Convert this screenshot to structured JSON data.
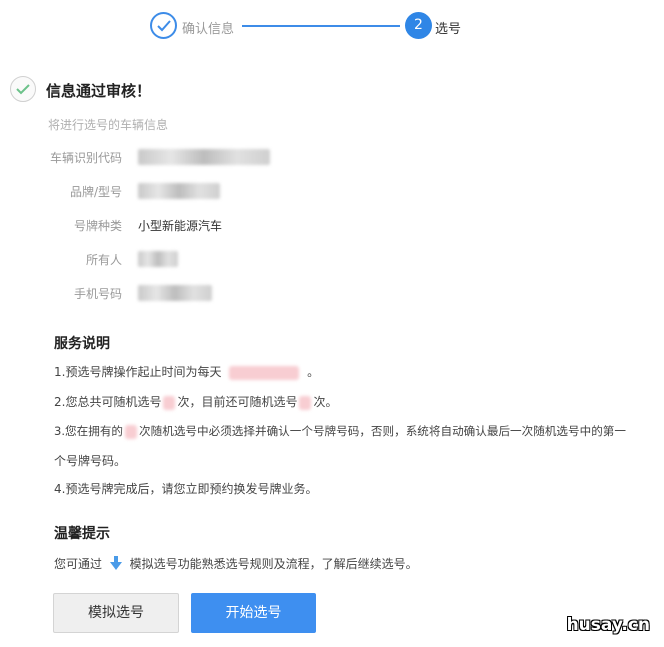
{
  "steps": {
    "step1_label": "确认信息",
    "step2_number": "2",
    "step2_label": "选号"
  },
  "success": {
    "title": "信息通过审核！",
    "subtitle": "将进行选号的车辆信息"
  },
  "info": {
    "vin_label": "车辆识别代码",
    "model_label": "品牌/型号",
    "plate_type_label": "号牌种类",
    "plate_type_value": "小型新能源汽车",
    "owner_label": "所有人",
    "phone_label": "手机号码"
  },
  "service": {
    "title": "服务说明",
    "item1_a": "1.预选号牌操作起止时间为每天",
    "item1_b": "。",
    "item2_a": "2.您总共可随机选号",
    "item2_b": "次，目前还可随机选号",
    "item2_c": "次。",
    "item3_a": "3.您在拥有的",
    "item3_b": "次随机选号中必须选择并确认一个号牌号码，否则，系统将自动确认最后一次随机选号中的第一",
    "item3_c": "个号牌号码。",
    "item4": "4.预选号牌完成后，请您立即预约换发号牌业务。"
  },
  "tips": {
    "title": "温馨提示",
    "text_a": "您可通过",
    "text_b": "模拟选号功能熟悉选号规则及流程，了解后继续选号。"
  },
  "buttons": {
    "simulate": "模拟选号",
    "start": "开始选号"
  },
  "watermark": "husay.cn",
  "colors": {
    "primary": "#3e8ff0",
    "step_blue": "#2f86e6",
    "mask_pink": "#f8cdd2"
  }
}
